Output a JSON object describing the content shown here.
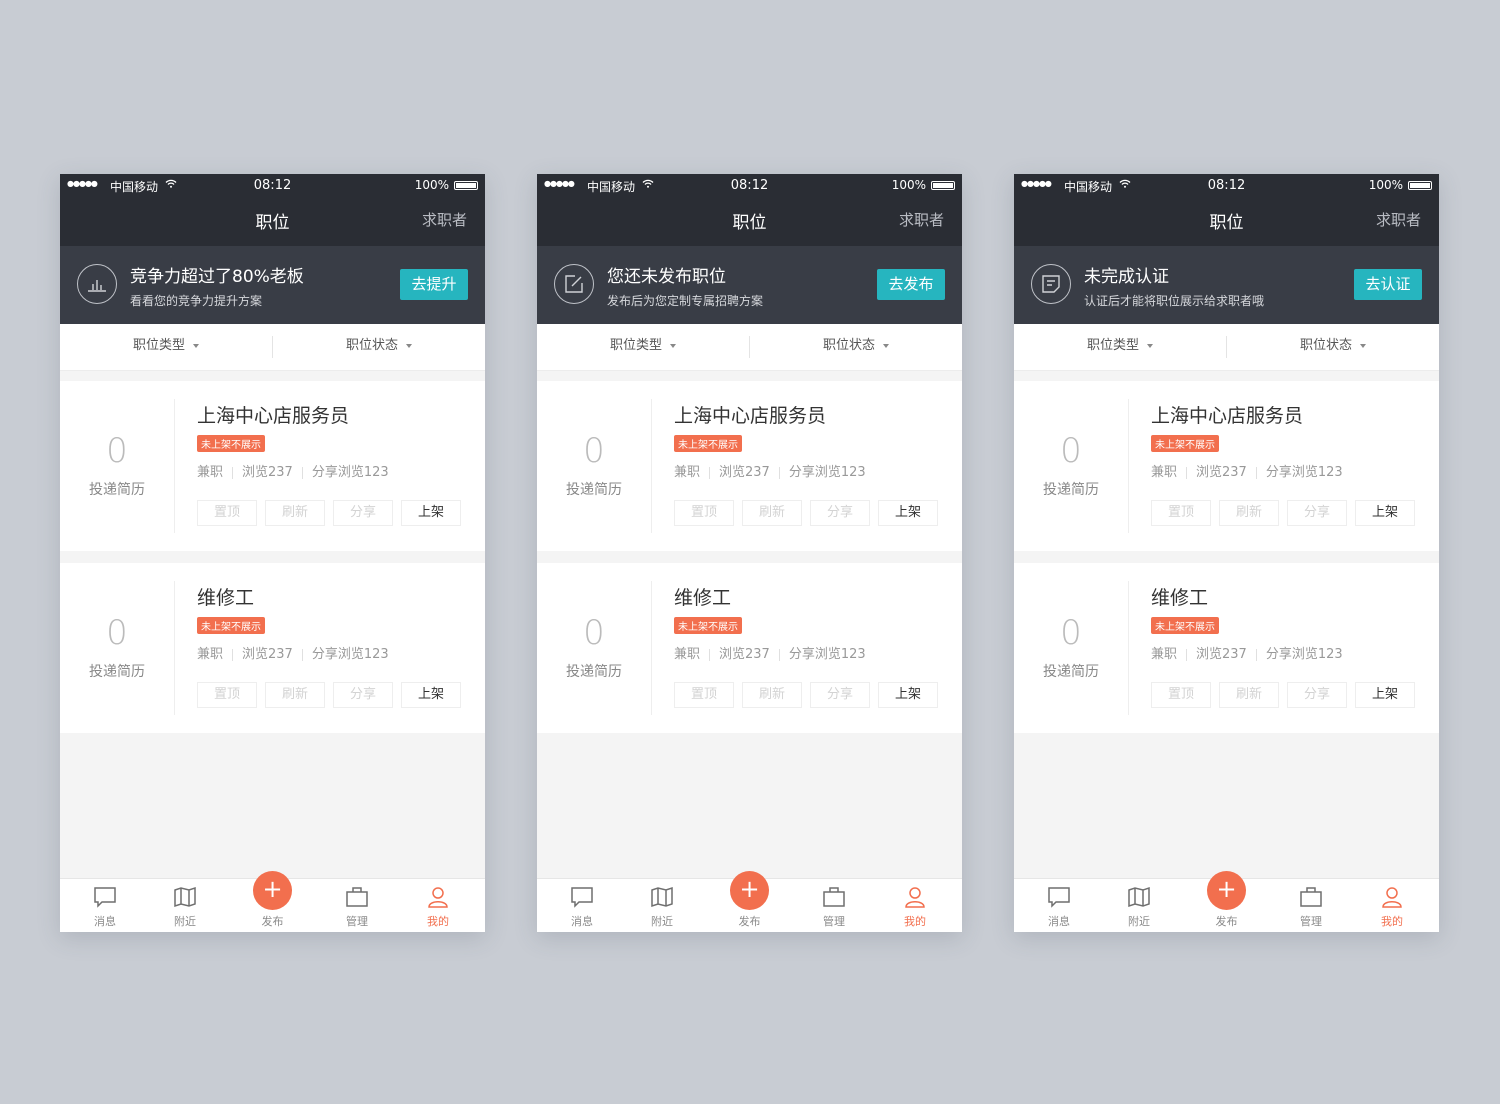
{
  "colors": {
    "accent": "#26b5bf",
    "orange": "#f26f4e",
    "header": "#2a2d34",
    "banner": "#393d46"
  },
  "status": {
    "carrier": "中国移动",
    "time": "08:12",
    "battery": "100%"
  },
  "nav": {
    "title": "职位",
    "right_link": "求职者"
  },
  "filters": {
    "type": "职位类型",
    "status": "职位状态"
  },
  "jobs": [
    {
      "count": "0",
      "count_label": "投递简历",
      "title": "上海中心店服务员",
      "tag": "未上架不展示",
      "type": "兼职",
      "views": "浏览237",
      "share_views": "分享浏览123",
      "buttons": [
        "置顶",
        "刷新",
        "分享",
        "上架"
      ]
    },
    {
      "count": "0",
      "count_label": "投递简历",
      "title": "维修工",
      "tag": "未上架不展示",
      "type": "兼职",
      "views": "浏览237",
      "share_views": "分享浏览123",
      "buttons": [
        "置顶",
        "刷新",
        "分享",
        "上架"
      ]
    }
  ],
  "tabs": {
    "messages": "消息",
    "nearby": "附近",
    "publish": "发布",
    "manage": "管理",
    "mine": "我的"
  },
  "screens": [
    {
      "banner": {
        "icon": "bar-chart-icon",
        "title": "竞争力超过了80%老板",
        "subtitle": "看看您的竞争力提升方案",
        "button": "去提升"
      }
    },
    {
      "banner": {
        "icon": "edit-icon",
        "title": "您还未发布职位",
        "subtitle": "发布后为您定制专属招聘方案",
        "button": "去发布"
      }
    },
    {
      "banner": {
        "icon": "document-icon",
        "title": "未完成认证",
        "subtitle": "认证后才能将职位展示给求职者哦",
        "button": "去认证"
      }
    }
  ]
}
